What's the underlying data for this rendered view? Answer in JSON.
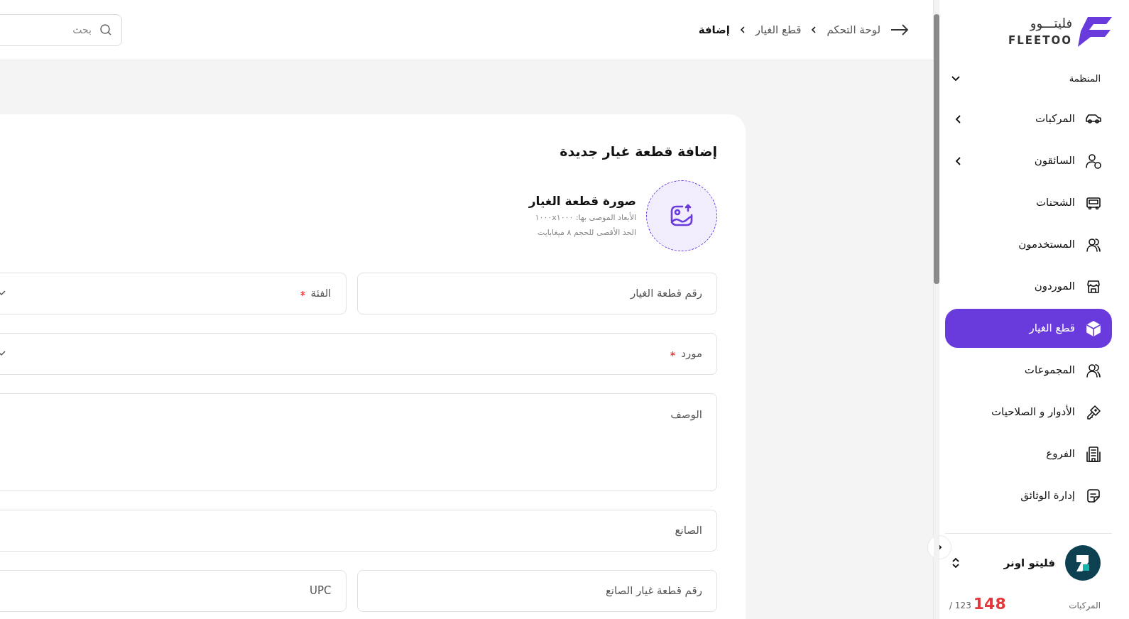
{
  "header": {
    "breadcrumb": [
      {
        "label": "لوحة التحكم",
        "current": false
      },
      {
        "label": "قطع الغيار",
        "current": false
      },
      {
        "label": "إضافة",
        "current": true
      }
    ],
    "search": {
      "placeholder": "بحث"
    }
  },
  "sidebar": {
    "logo": {
      "arabic": "فليتـــوو",
      "latin": "FLEETOO"
    },
    "section": {
      "label": "المنظمة",
      "expanded": true
    },
    "items": [
      {
        "label": "المركبات",
        "kind": "group",
        "expanded": false,
        "selected": false
      },
      {
        "label": "السائقون",
        "kind": "group",
        "expanded": false,
        "selected": false
      },
      {
        "label": "الشحنات",
        "kind": "link",
        "selected": false
      },
      {
        "label": "المستخدمون",
        "kind": "link",
        "selected": false
      },
      {
        "label": "الموردون",
        "kind": "link",
        "selected": false
      },
      {
        "label": "قطع الغيار",
        "kind": "link",
        "selected": true
      },
      {
        "label": "المجموعات",
        "kind": "link",
        "selected": false
      },
      {
        "label": "الأدوار و الصلاحيات",
        "kind": "link",
        "selected": false
      },
      {
        "label": "الفروع",
        "kind": "link",
        "selected": false
      },
      {
        "label": "إدارة الوثائق",
        "kind": "link",
        "selected": false
      }
    ],
    "account": {
      "name": "فليتو اونر",
      "usage_label": "المركبات",
      "used": "148",
      "limit": "/ 123"
    }
  },
  "form": {
    "title": "إضافة قطعة غيار جديدة",
    "image": {
      "title": "صورة قطعة الغيار",
      "hints": [
        "الأبعاد الموصى بها: ١٠٠٠x١٠٠٠",
        "الحد الأقصى للحجم ٨ ميغابايت"
      ]
    },
    "rows": [
      [
        {
          "kind": "text",
          "placeholder": "رقم قطعة الغيار"
        },
        {
          "kind": "select",
          "placeholder": "الفئة",
          "required": true
        }
      ],
      [
        {
          "kind": "select",
          "placeholder": "مورد",
          "required": true
        }
      ],
      [
        {
          "kind": "textarea",
          "placeholder": "الوصف"
        }
      ],
      [
        {
          "kind": "text",
          "placeholder": "الصانع"
        }
      ],
      [
        {
          "kind": "text",
          "placeholder": "رقم قطعة غيار الصانع"
        },
        {
          "kind": "text",
          "placeholder": "UPC"
        }
      ]
    ]
  }
}
